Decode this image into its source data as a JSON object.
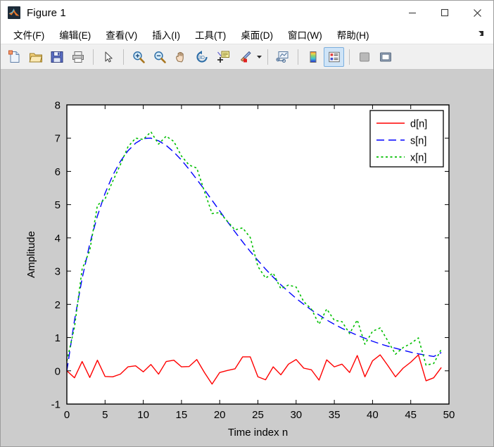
{
  "window": {
    "title": "Figure 1",
    "icon": "matlab-icon",
    "minimize_label": "–",
    "maximize_label": "□",
    "close_label": "✕"
  },
  "menubar": {
    "items": [
      {
        "label": "文件(F)",
        "name": "menu-file"
      },
      {
        "label": "编辑(E)",
        "name": "menu-edit"
      },
      {
        "label": "查看(V)",
        "name": "menu-view"
      },
      {
        "label": "插入(I)",
        "name": "menu-insert"
      },
      {
        "label": "工具(T)",
        "name": "menu-tools"
      },
      {
        "label": "桌面(D)",
        "name": "menu-desktop"
      },
      {
        "label": "窗口(W)",
        "name": "menu-window"
      },
      {
        "label": "帮助(H)",
        "name": "menu-help"
      }
    ],
    "dock_icon": "dock-arrow-icon"
  },
  "toolbar": {
    "items": [
      {
        "name": "new-figure-icon",
        "selected": false
      },
      {
        "name": "open-file-icon",
        "selected": false
      },
      {
        "name": "save-figure-icon",
        "selected": false
      },
      {
        "name": "print-figure-icon",
        "selected": false
      },
      {
        "name": "pointer-icon",
        "selected": false
      },
      {
        "name": "zoom-in-icon",
        "selected": false
      },
      {
        "name": "zoom-out-icon",
        "selected": false
      },
      {
        "name": "pan-icon",
        "selected": false
      },
      {
        "name": "rotate-3d-icon",
        "selected": false
      },
      {
        "name": "data-cursor-icon",
        "selected": false
      },
      {
        "name": "brush-icon",
        "selected": false
      },
      {
        "name": "brush-dropdown-caret-icon",
        "selected": false
      },
      {
        "name": "link-plot-icon",
        "selected": false
      },
      {
        "name": "colorbar-icon",
        "selected": false
      },
      {
        "name": "legend-icon",
        "selected": true
      },
      {
        "name": "hide-plot-tools-icon",
        "selected": false
      },
      {
        "name": "show-plot-tools-icon",
        "selected": false
      }
    ]
  },
  "figure": {
    "background_color": "#cccccc",
    "axes_background_color": "#ffffff",
    "axes_edge_color": "#000000"
  },
  "chart_data": {
    "type": "line",
    "title": "",
    "xlabel": "Time index n",
    "ylabel": "Amplitude",
    "xlim": [
      0,
      50
    ],
    "ylim": [
      -1,
      8
    ],
    "xticks": [
      0,
      5,
      10,
      15,
      20,
      25,
      30,
      35,
      40,
      45,
      50
    ],
    "yticks": [
      -1,
      0,
      1,
      2,
      3,
      4,
      5,
      6,
      7,
      8
    ],
    "grid": false,
    "legend": {
      "position": "upper-right",
      "entries": [
        "d[n]",
        "s[n]",
        "x[n]"
      ]
    },
    "x": [
      0,
      1,
      2,
      3,
      4,
      5,
      6,
      7,
      8,
      9,
      10,
      11,
      12,
      13,
      14,
      15,
      16,
      17,
      18,
      19,
      20,
      21,
      22,
      23,
      24,
      25,
      26,
      27,
      28,
      29,
      30,
      31,
      32,
      33,
      34,
      35,
      36,
      37,
      38,
      39,
      40,
      41,
      42,
      43,
      44,
      45,
      46,
      47,
      48,
      49
    ],
    "series": [
      {
        "name": "d[n]",
        "color": "#ff0000",
        "linestyle": "solid",
        "values": [
          0.0,
          -0.21,
          0.28,
          -0.2,
          0.32,
          -0.17,
          -0.18,
          -0.1,
          0.12,
          0.15,
          -0.03,
          0.19,
          -0.1,
          0.28,
          0.32,
          0.12,
          0.13,
          0.34,
          -0.05,
          -0.4,
          -0.05,
          0.01,
          0.06,
          0.42,
          0.42,
          -0.18,
          -0.27,
          0.12,
          -0.12,
          0.2,
          0.34,
          0.08,
          0.03,
          -0.28,
          0.33,
          0.12,
          0.2,
          -0.05,
          0.46,
          -0.18,
          0.3,
          0.48,
          0.16,
          -0.18,
          0.08,
          0.26,
          0.48,
          -0.3,
          -0.21,
          0.1
        ]
      },
      {
        "name": "s[n]",
        "color": "#0000ff",
        "linestyle": "dashed",
        "values": [
          0.0,
          1.52,
          2.78,
          3.82,
          4.66,
          5.34,
          5.88,
          6.3,
          6.62,
          6.85,
          6.99,
          7.0,
          6.92,
          6.78,
          6.58,
          6.34,
          6.06,
          5.76,
          5.45,
          5.13,
          4.81,
          4.49,
          4.18,
          3.88,
          3.59,
          3.32,
          3.06,
          2.82,
          2.59,
          2.38,
          2.18,
          2.0,
          1.83,
          1.68,
          1.53,
          1.4,
          1.28,
          1.17,
          1.07,
          0.98,
          0.89,
          0.81,
          0.74,
          0.68,
          0.62,
          0.56,
          0.51,
          0.47,
          0.43,
          0.55
        ]
      },
      {
        "name": "x[n]",
        "color": "#00bf00",
        "linestyle": "dotted",
        "values": [
          0.3,
          1.31,
          3.06,
          3.62,
          4.98,
          5.17,
          5.7,
          6.2,
          6.74,
          7.0,
          6.96,
          7.19,
          6.82,
          7.06,
          6.9,
          6.46,
          6.19,
          6.1,
          5.4,
          4.73,
          4.76,
          4.5,
          4.24,
          4.3,
          4.01,
          3.14,
          2.79,
          2.94,
          2.47,
          2.58,
          2.52,
          2.08,
          1.86,
          1.4,
          1.86,
          1.52,
          1.48,
          1.12,
          1.53,
          0.8,
          1.19,
          1.29,
          0.9,
          0.5,
          0.7,
          0.82,
          0.99,
          0.17,
          0.22,
          0.65
        ]
      }
    ]
  }
}
